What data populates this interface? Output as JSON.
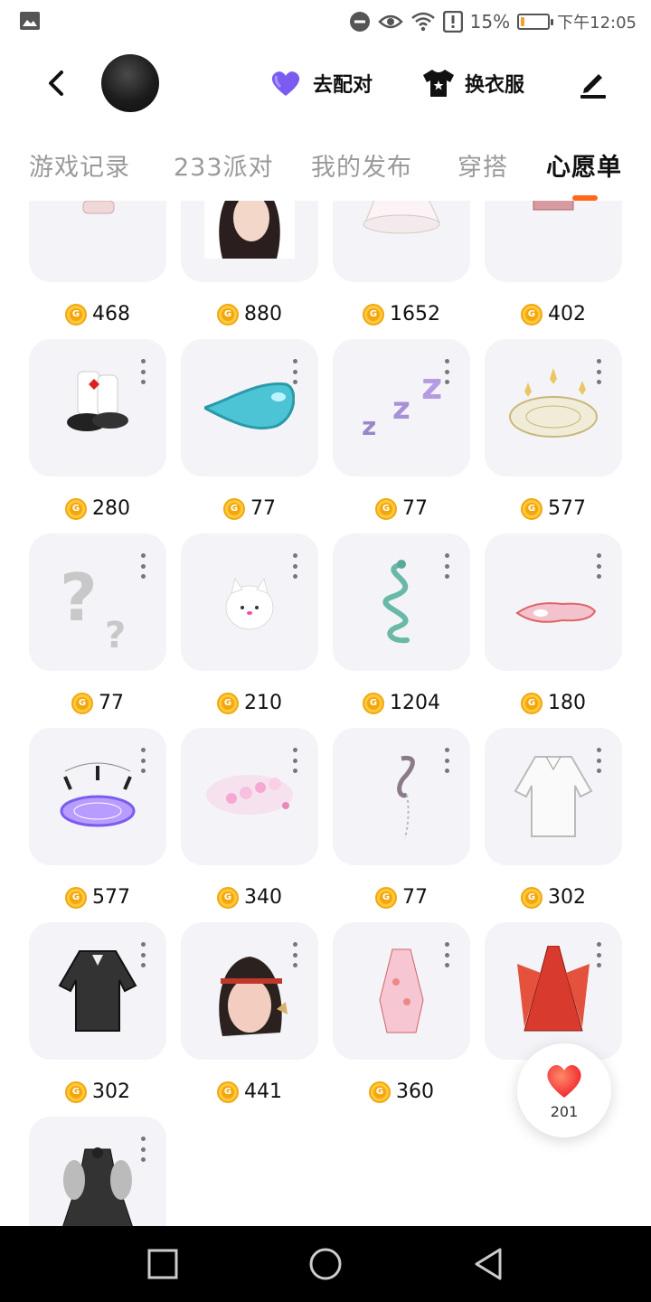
{
  "status_bar": {
    "battery_percent": "15%",
    "time": "下午12:05",
    "battery_level": 0.15
  },
  "top_bar": {
    "match_label": "去配对",
    "dress_label": "换衣服"
  },
  "tabs": [
    {
      "label": "游戏记录",
      "active": false
    },
    {
      "label": "233派对",
      "active": false
    },
    {
      "label": "我的发布",
      "active": false
    },
    {
      "label": "穿搭",
      "active": false
    },
    {
      "label": "心愿单",
      "active": true
    }
  ],
  "items": [
    {
      "price": "468",
      "icon": "outfit-socks-icon"
    },
    {
      "price": "880",
      "icon": "hairstyle-bow-icon"
    },
    {
      "price": "1652",
      "icon": "white-dress-icon"
    },
    {
      "price": "402",
      "icon": "pink-shoes-icon"
    },
    {
      "price": "280",
      "icon": "boots-leg-warmers-icon"
    },
    {
      "price": "77",
      "icon": "blue-drop-icon"
    },
    {
      "price": "77",
      "icon": "zzz-effect-icon"
    },
    {
      "price": "577",
      "icon": "gold-halo-icon"
    },
    {
      "price": "77",
      "icon": "question-mark-icon"
    },
    {
      "price": "210",
      "icon": "white-cat-icon"
    },
    {
      "price": "1204",
      "icon": "green-snake-icon"
    },
    {
      "price": "180",
      "icon": "pink-slippers-icon"
    },
    {
      "price": "577",
      "icon": "purple-magic-circle-icon"
    },
    {
      "price": "340",
      "icon": "pink-sparkle-effect-icon"
    },
    {
      "price": "77",
      "icon": "hair-clip-chain-icon"
    },
    {
      "price": "302",
      "icon": "white-coat-icon"
    },
    {
      "price": "302",
      "icon": "black-coat-icon"
    },
    {
      "price": "441",
      "icon": "hair-ribbon-icon"
    },
    {
      "price": "360",
      "icon": "pink-qipao-icon"
    },
    {
      "price": "",
      "icon": "red-hanfu-icon"
    },
    {
      "price": "",
      "icon": "gothic-dress-icon"
    }
  ],
  "fab": {
    "count": "201"
  },
  "colors": {
    "accent": "#ff6a1a",
    "coin": "#ffc93c",
    "match_heart": "#7a5cf0"
  }
}
